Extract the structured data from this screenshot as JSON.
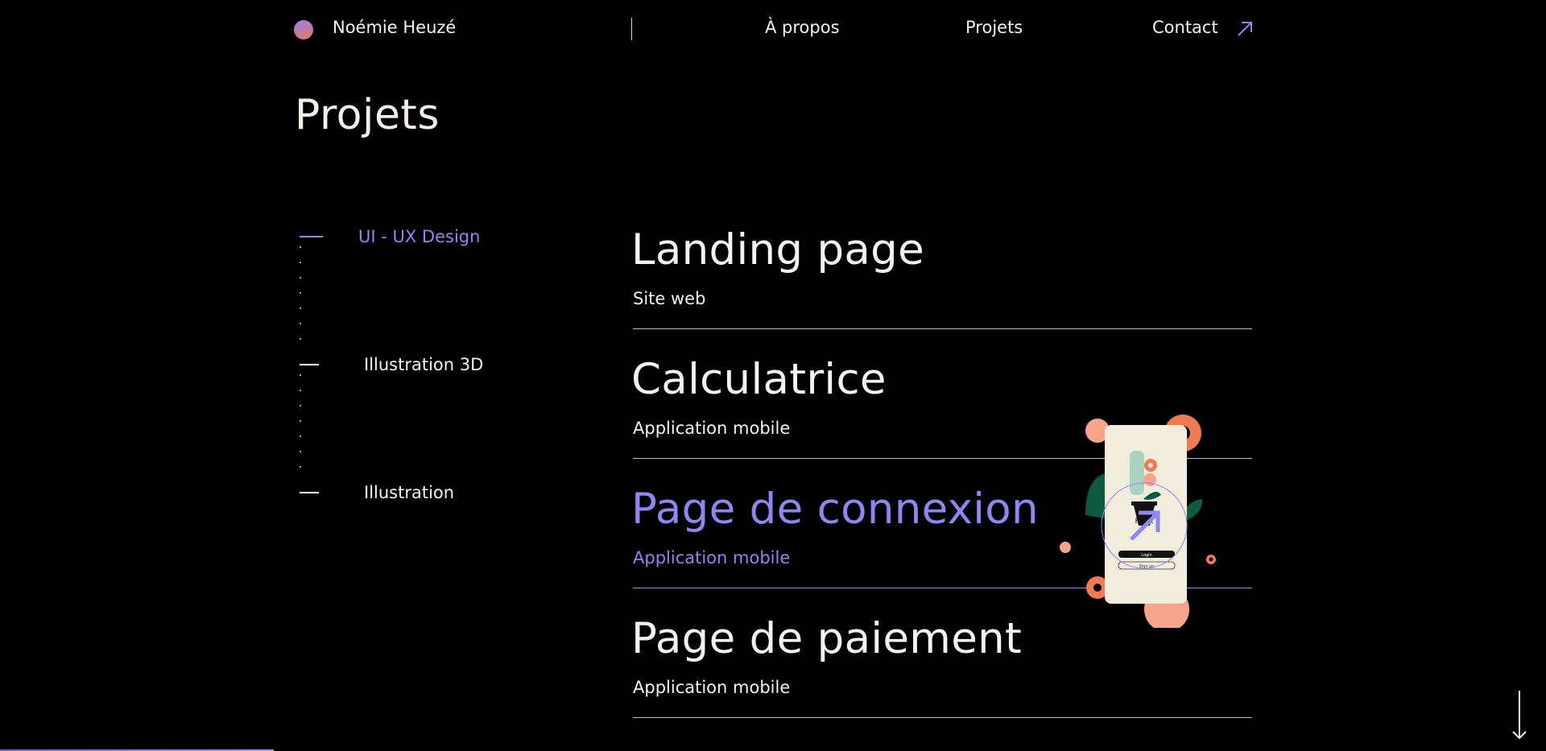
{
  "header": {
    "brand": "Noémie Heuzé",
    "nav": {
      "about": "À propos",
      "projects": "Projets",
      "contact": "Contact"
    }
  },
  "page": {
    "title": "Projets"
  },
  "categories": [
    {
      "label": "UI - UX Design",
      "active": true
    },
    {
      "label": "Illustration 3D",
      "active": false
    },
    {
      "label": "Illustration",
      "active": false
    }
  ],
  "projects": [
    {
      "title": "Landing page",
      "subtitle": "Site web"
    },
    {
      "title": "Calculatrice",
      "subtitle": "Application mobile"
    },
    {
      "title": "Page de connexion",
      "subtitle": "Application mobile",
      "hovered": true
    },
    {
      "title": "Page de paiement",
      "subtitle": "Application mobile"
    }
  ],
  "preview": {
    "screen_title": "Plant",
    "login_label": "Login",
    "signup_label": "Sign up"
  },
  "colors": {
    "accent": "#8f86f0",
    "background": "#000000",
    "text": "#f3f3f3",
    "title": "#f3efe6",
    "coral": "#f07a52",
    "pink": "#f4a58a",
    "green": "#0c5a3f",
    "cream": "#f1ecdc"
  }
}
